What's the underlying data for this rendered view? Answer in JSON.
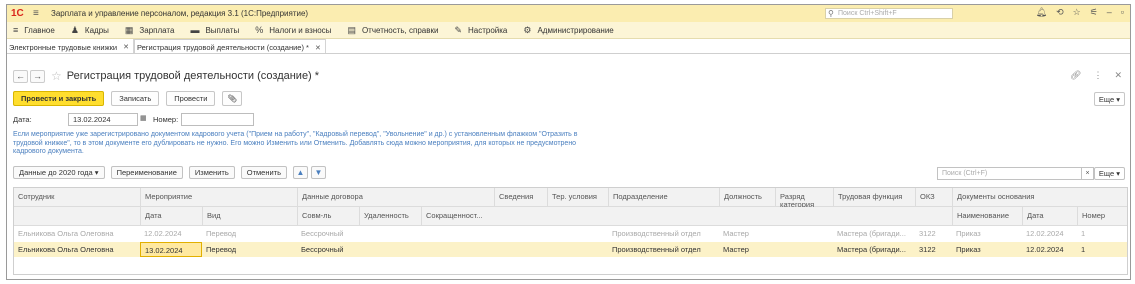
{
  "titlebar": {
    "logo": "1С",
    "app_title": "Зарплата и управление персоналом, редакция 3.1  (1С:Предприятие)",
    "search_placeholder": "Поиск Ctrl+Shift+F"
  },
  "sections": [
    {
      "icon": "menu-icon",
      "glyph": "≡",
      "label": "Главное"
    },
    {
      "icon": "people-icon",
      "glyph": "👥",
      "label": "Кадры"
    },
    {
      "icon": "calc-icon",
      "glyph": "▦",
      "label": "Зарплата"
    },
    {
      "icon": "money-icon",
      "glyph": "▬",
      "label": "Выплаты"
    },
    {
      "icon": "percent-icon",
      "glyph": "%",
      "label": "Налоги и взносы"
    },
    {
      "icon": "report-icon",
      "glyph": "▤",
      "label": "Отчетность, справки"
    },
    {
      "icon": "wrench-icon",
      "glyph": "✎",
      "label": "Настройка"
    },
    {
      "icon": "gear-icon",
      "glyph": "⚙",
      "label": "Администрирование"
    }
  ],
  "tabs": [
    {
      "label": "Электронные трудовые книжки"
    },
    {
      "label": "Регистрация трудовой деятельности (создание) *"
    }
  ],
  "form": {
    "title": "Регистрация трудовой деятельности (создание) *",
    "buttons": {
      "post_close": "Провести и закрыть",
      "save": "Записать",
      "post": "Провести",
      "more": "Еще"
    },
    "date_label": "Дата:",
    "date_value": "13.02.2024",
    "number_label": "Номер:",
    "number_value": "",
    "note": "Если мероприятие уже зарегистрировано документом кадрового учета (\"Прием на работу\", \"Кадровый перевод\", \"Увольнение\" и др.) с установленным флажком \"Отразить в трудовой книжке\", то в этом документе его дублировать не нужно. Его можно Изменить или Отменить. Добавлять сюда можно мероприятия, для которых не предусмотрено кадрового документа."
  },
  "grid": {
    "buttons": {
      "before2020": "Данные до 2020 года",
      "rename": "Переименование",
      "change": "Изменить",
      "cancel": "Отменить",
      "more": "Еще"
    },
    "search_placeholder": "Поиск (Ctrl+F)",
    "headers": {
      "employee": "Сотрудник",
      "event": "Мероприятие",
      "event_date": "Дата",
      "event_kind": "Вид",
      "contract": "Данные договора",
      "combo": "Совм-ль",
      "remote": "Удаленность",
      "reduced": "Сокращенност...",
      "info": "Сведения",
      "ter": "Тер. условия",
      "dept": "Подразделение",
      "position": "Должность",
      "rank": "Разряд категория",
      "function": "Трудовая функция",
      "okz": "ОКЗ",
      "docs": "Документы основания",
      "doc_name": "Наименование",
      "doc_date": "Дата",
      "doc_num": "Номер"
    },
    "rows": [
      {
        "employee": "Ельникова Ольга Олеговна",
        "date": "12.02.2024",
        "kind": "Перевод",
        "combo": "Бессрочный",
        "dept": "Производственный отдел",
        "position": "Мастер",
        "function": "Мастера (бригади...",
        "okz": "3122",
        "doc_name": "Приказ",
        "doc_date": "12.02.2024",
        "doc_num": "1"
      },
      {
        "employee": "Ельникова Ольга Олеговна",
        "date": "13.02.2024",
        "kind": "Перевод",
        "combo": "Бессрочный",
        "dept": "Производственный отдел",
        "position": "Мастер",
        "function": "Мастера (бригади...",
        "okz": "3122",
        "doc_name": "Приказ",
        "doc_date": "12.02.2024",
        "doc_num": "1"
      }
    ]
  },
  "colors": {
    "titlebar": "#fbedb0",
    "primary_button": "#ffde2e",
    "selected_row": "#fcf2c8",
    "note_text": "#4a7fbf"
  }
}
